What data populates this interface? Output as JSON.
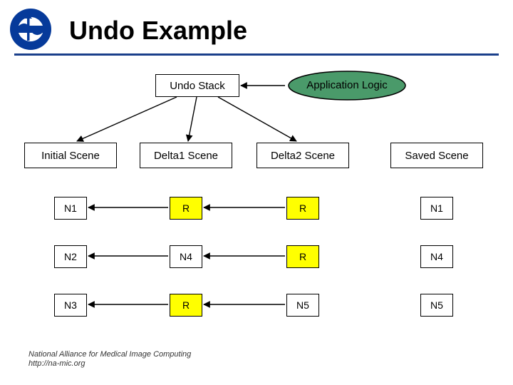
{
  "title": "Undo Example",
  "top_boxes": {
    "undo_stack": "Undo Stack",
    "app_logic": "Application Logic"
  },
  "scene_headers": {
    "initial": "Initial Scene",
    "delta1": "Delta1 Scene",
    "delta2": "Delta2 Scene",
    "saved": "Saved Scene"
  },
  "rows": [
    {
      "initial": "N1",
      "delta1": "R",
      "delta2": "R",
      "saved": "N1"
    },
    {
      "initial": "N2",
      "delta1": "N4",
      "delta2": "R",
      "saved": "N4"
    },
    {
      "initial": "N3",
      "delta1": "R",
      "delta2": "N5",
      "saved": "N5"
    }
  ],
  "footer_line1": "National Alliance for Medical Image Computing",
  "footer_line2": "http://na-mic.org",
  "colors": {
    "node_white": "#ffffff",
    "node_yellow": "#ffff00",
    "app_logic_fill": "#4a9a6a",
    "rule": "#1a3f8b"
  }
}
